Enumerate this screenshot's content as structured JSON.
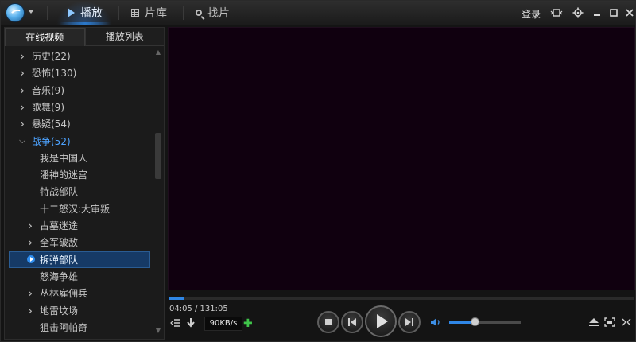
{
  "titlebar": {
    "tabs": [
      {
        "label": "播放",
        "icon": "play-icon",
        "active": true
      },
      {
        "label": "片库",
        "icon": "grid-icon",
        "active": false
      },
      {
        "label": "找片",
        "icon": "search-icon",
        "active": false
      }
    ],
    "login_label": "登录",
    "window_buttons": [
      "mini-mode-icon",
      "settings-icon",
      "minimize-icon",
      "maximize-icon",
      "close-icon"
    ]
  },
  "sidebar": {
    "tabs": [
      {
        "label": "在线视频",
        "active": true
      },
      {
        "label": "播放列表",
        "active": false
      }
    ],
    "tree": [
      {
        "label": "历史(22)",
        "level": 0,
        "expander": "collapsed"
      },
      {
        "label": "恐怖(130)",
        "level": 0,
        "expander": "collapsed"
      },
      {
        "label": "音乐(9)",
        "level": 0,
        "expander": "collapsed"
      },
      {
        "label": "歌舞(9)",
        "level": 0,
        "expander": "collapsed"
      },
      {
        "label": "悬疑(54)",
        "level": 0,
        "expander": "collapsed"
      },
      {
        "label": "战争(52)",
        "level": 0,
        "expander": "expanded"
      },
      {
        "label": "我是中国人",
        "level": 1,
        "expander": "none"
      },
      {
        "label": "潘神的迷宫",
        "level": 1,
        "expander": "none"
      },
      {
        "label": "特战部队",
        "level": 1,
        "expander": "none"
      },
      {
        "label": "十二怒汉:大审叛",
        "level": 1,
        "expander": "none"
      },
      {
        "label": "古墓迷途",
        "level": 1,
        "expander": "collapsed"
      },
      {
        "label": "全军破敌",
        "level": 1,
        "expander": "collapsed"
      },
      {
        "label": "拆弹部队",
        "level": 1,
        "expander": "playing"
      },
      {
        "label": "怒海争雄",
        "level": 1,
        "expander": "none"
      },
      {
        "label": "丛林雇佣兵",
        "level": 1,
        "expander": "collapsed"
      },
      {
        "label": "地雷坟场",
        "level": 1,
        "expander": "collapsed"
      },
      {
        "label": "狙击阿帕奇",
        "level": 1,
        "expander": "none"
      }
    ]
  },
  "player": {
    "time": "04:05 / 131:05",
    "progress_fraction": 0.031,
    "speed": "90KB/s",
    "volume_fraction": 0.35
  },
  "colors": {
    "accent": "#2f86e6",
    "video_bg": "#10000f",
    "selected_row": "#163a66",
    "add_green": "#3fc44a"
  }
}
